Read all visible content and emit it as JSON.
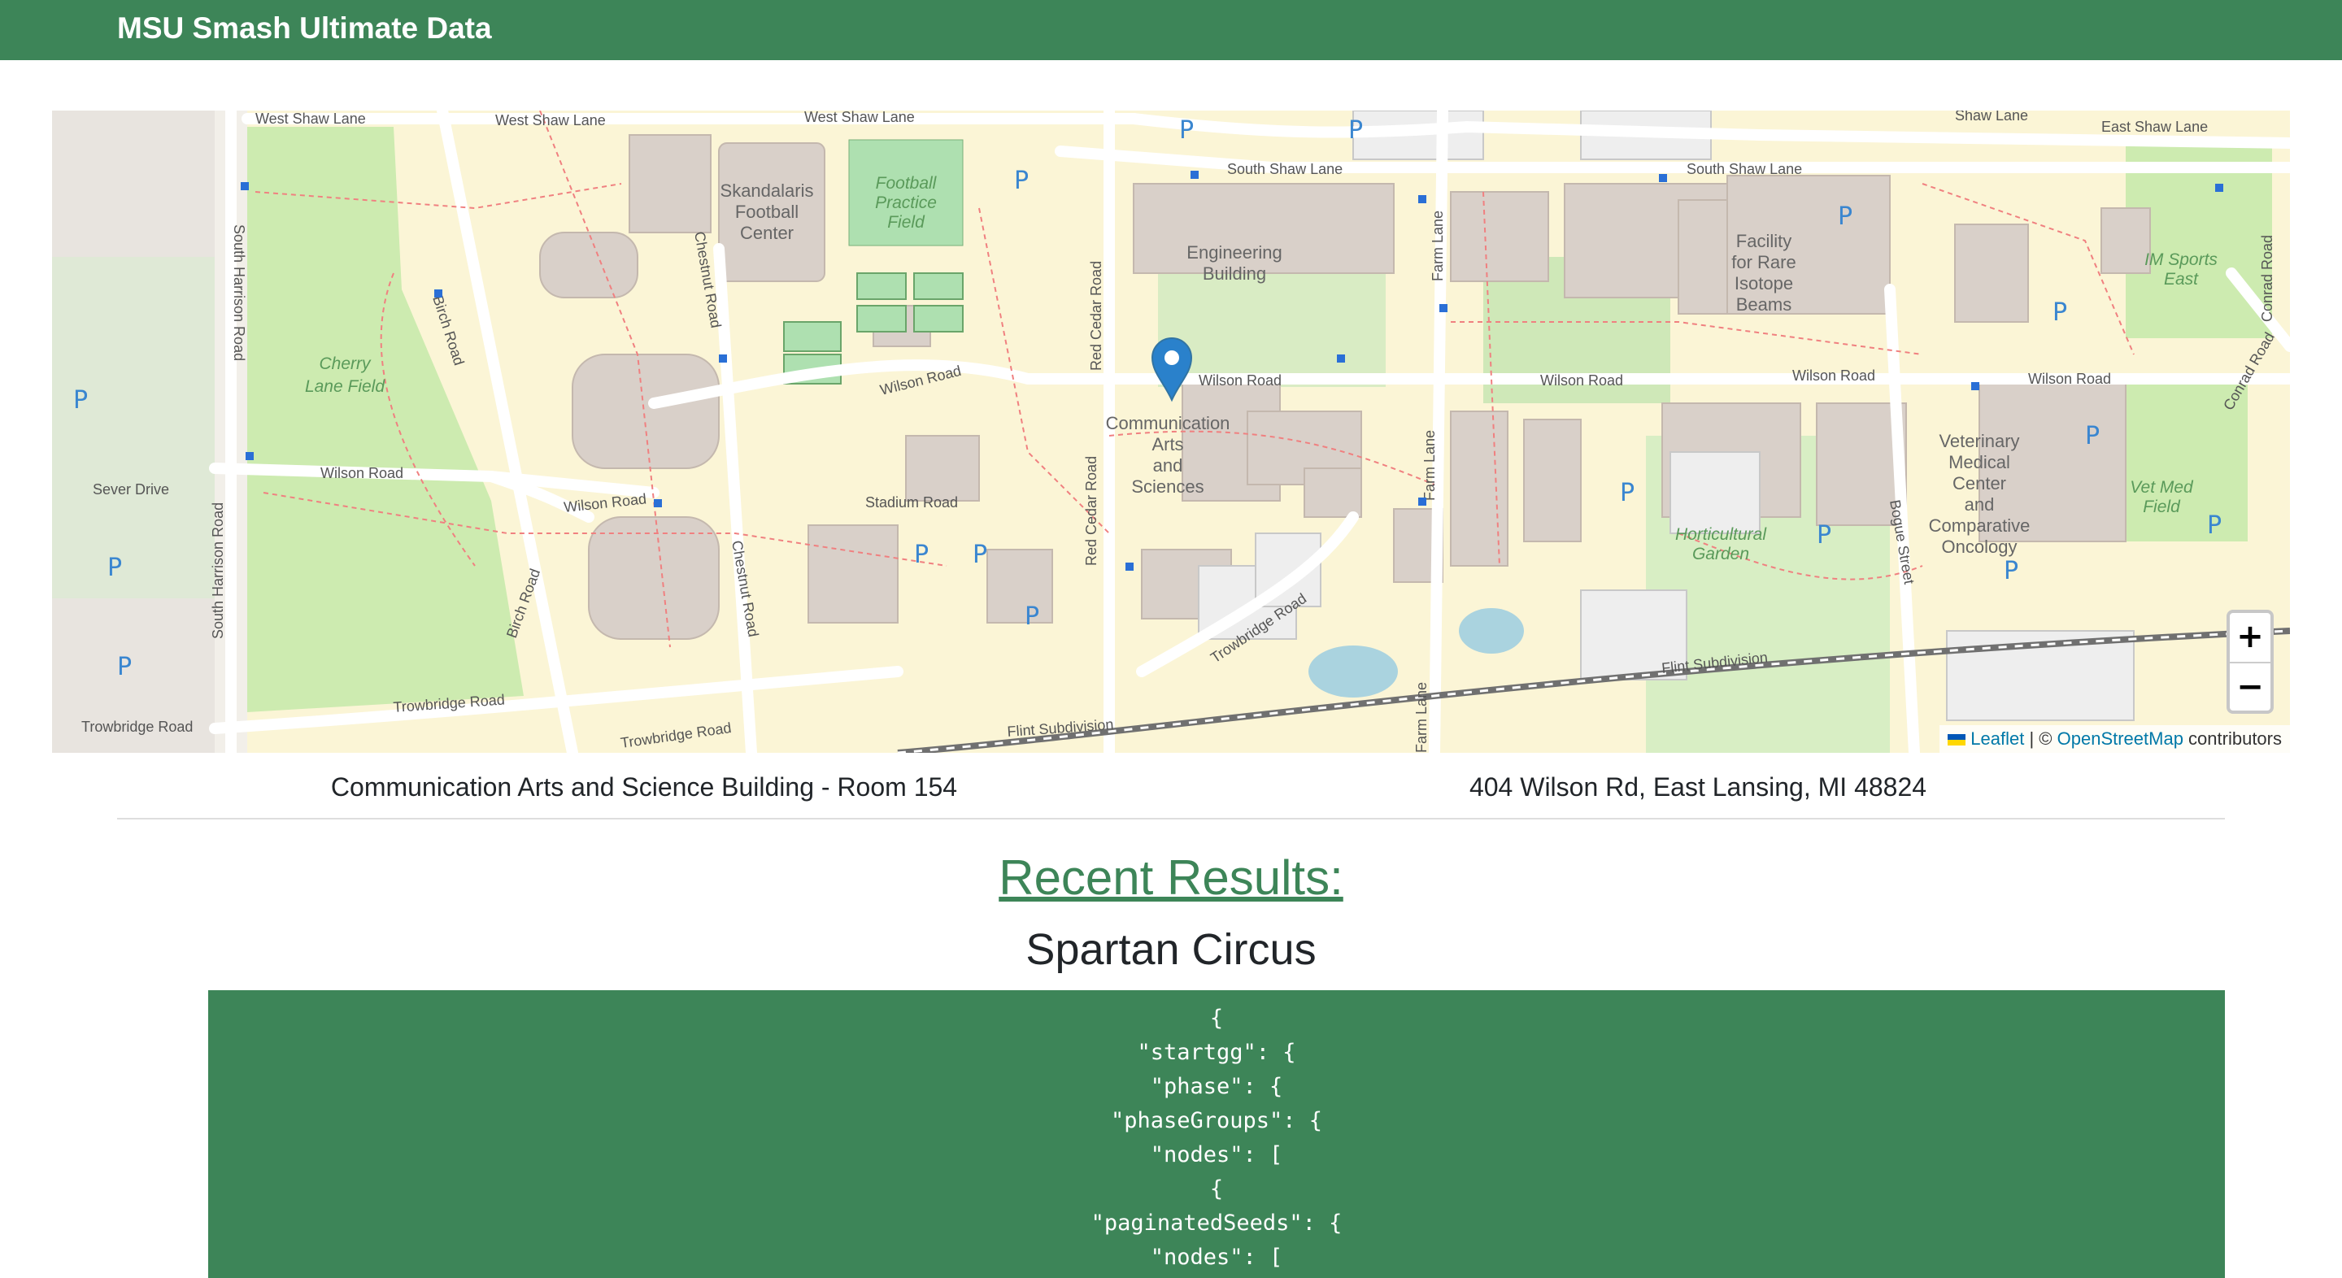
{
  "navbar": {
    "brand": "MSU Smash Ultimate Data"
  },
  "map": {
    "zoom_in": "+",
    "zoom_out": "−",
    "attribution": {
      "leaflet": "Leaflet",
      "separator": " | © ",
      "osm": "OpenStreetMap",
      "suffix": " contributors"
    },
    "labels": {
      "west_shaw_1": "West Shaw Lane",
      "west_shaw_2": "West Shaw Lane",
      "south_shaw_1": "South Shaw Lane",
      "south_shaw_2": "South Shaw Lane",
      "east_shaw": "East Shaw Lane",
      "shaw_lane": "Shaw Lane",
      "skandalaris_1": "Skandalaris",
      "skandalaris_2": "Football",
      "skandalaris_3": "Center",
      "fpf_1": "Football",
      "fpf_2": "Practice",
      "fpf_3": "Field",
      "engineering_1": "Engineering",
      "engineering_2": "Building",
      "frib_1": "Facility",
      "frib_2": "for Rare",
      "frib_3": "Isotope",
      "frib_4": "Beams",
      "im_sports_1": "IM Sports",
      "im_sports_2": "East",
      "cherry_1": "Cherry",
      "cherry_2": "Lane Field",
      "wilson_1": "Wilson Road",
      "wilson_2": "Wilson Road",
      "wilson_3": "Wilson Road",
      "wilson_4": "Wilson Road",
      "wilson_5": "Wilson Road",
      "wilson_6": "Wilson Road",
      "wilson_7": "Wilson Road",
      "sever": "Sever Drive",
      "cas_1": "Communication",
      "cas_2": "Arts",
      "cas_3": "and",
      "cas_4": "Sciences",
      "stadium": "Stadium Road",
      "vet_1": "Veterinary",
      "vet_2": "Medical",
      "vet_3": "Center",
      "vet_4": "and",
      "vet_5": "Comparative",
      "vet_6": "Oncology",
      "vet_field_1": "Vet Med",
      "vet_field_2": "Field",
      "horticultural_1": "Horticultural",
      "horticultural_2": "Garden",
      "trowbridge_1": "Trowbridge Road",
      "trowbridge_2": "Trowbridge Road",
      "trowbridge_3": "Trowbridge Road",
      "trowbridge_4": "Trowbridge Road",
      "flint_1": "Flint Subdivision",
      "flint_2": "Flint Subdivision",
      "south_harrison_1": "South Harrison Road",
      "south_harrison_2": "South Harrison Road",
      "birch_1": "Birch Road",
      "birch_2": "Birch Road",
      "chestnut_1": "Chestnut Road",
      "chestnut_2": "Chestnut Road",
      "red_cedar_1": "Red Cedar Road",
      "red_cedar_2": "Red Cedar Road",
      "farm_1": "Farm Lane",
      "farm_2": "Farm Lane",
      "farm_3": "Farm Lane",
      "bogue": "Bogue Street",
      "conrad_1": "Conrad Road",
      "conrad_2": "Conrad Road",
      "parking": "P"
    }
  },
  "venue": {
    "name": "Communication Arts and Science Building - Room 154",
    "address": "404 Wilson Rd, East Lansing, MI 48824"
  },
  "results": {
    "heading": "Recent Results:",
    "event_name": "Spartan Circus",
    "json_lines": [
      "{",
      "\"startgg\": {",
      "\"phase\": {",
      "\"phaseGroups\": {",
      "\"nodes\": [",
      "{",
      "\"paginatedSeeds\": {",
      "\"nodes\": ["
    ]
  },
  "colors": {
    "navbar": "#3d8558",
    "heading": "#3d8558",
    "code_bg": "#3d8558",
    "marker": "#2a81cb",
    "map_bg": "#f2efe9",
    "campus": "#fbf5d6",
    "grass": "#cdebb0",
    "building": "#d9d0c9",
    "road": "#ffffff",
    "railway": "#707070",
    "water": "#aad3df"
  }
}
